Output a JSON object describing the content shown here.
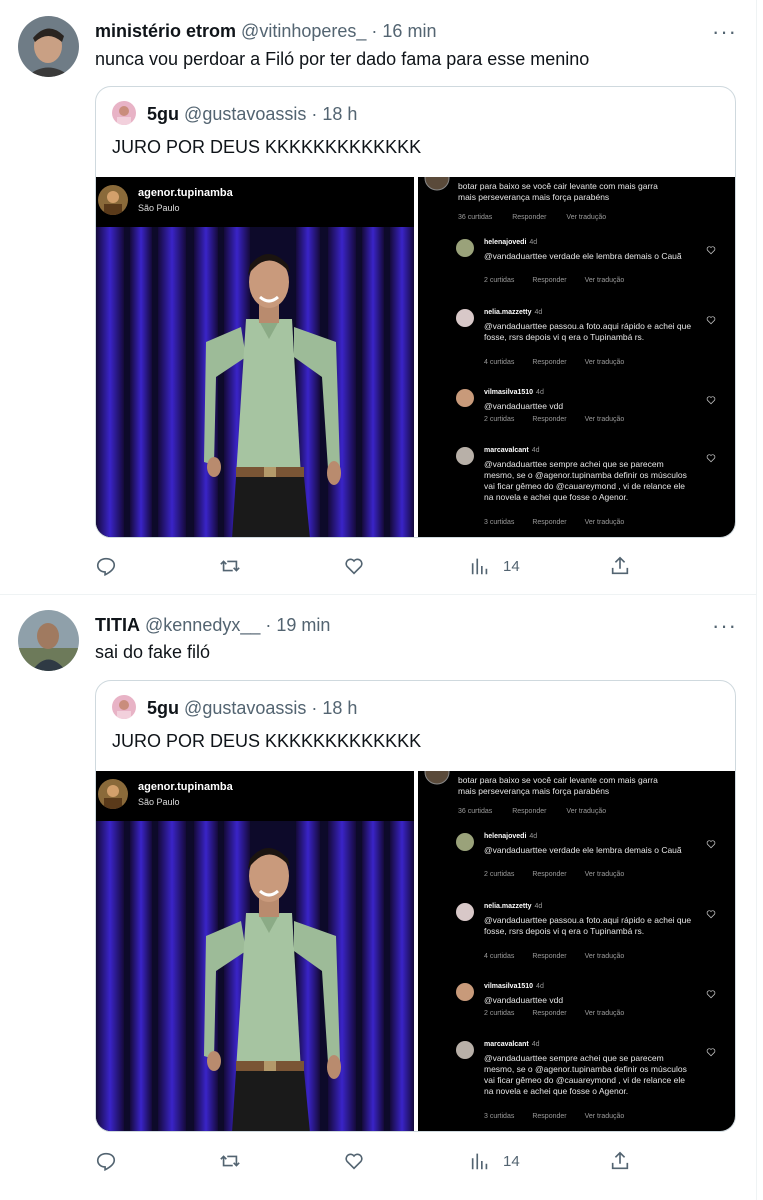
{
  "tweets": [
    {
      "name": "ministério etrom",
      "handle": "@vitinhoperes_",
      "dot": "·",
      "time": "16 min",
      "text": "nunca vou perdoar a Filó por ter dado fama para esse menino",
      "views": "14"
    },
    {
      "name": "TITIA",
      "handle": "@kennedyx__",
      "dot": "·",
      "time": "19 min",
      "text": "sai do fake filó",
      "views": "14"
    }
  ],
  "quote": {
    "name": "5gu",
    "handle": "@gustavoassis",
    "dot": "·",
    "time": "18 h",
    "text": "JURO POR DEUS KKKKKKKKKKKKK"
  },
  "instagram": {
    "user": "agenor.tupinamba",
    "location": "São Paulo",
    "top_comment": [
      "botar para baixo se você cair levante com mais garra",
      "mais perseverança mais força parabéns"
    ],
    "top_meta": [
      "36 curtidas",
      "Responder",
      "Ver tradução"
    ],
    "comments": [
      {
        "user": "helenajovedi",
        "ago": "4d",
        "text": "@vandaduarttee verdade ele lembra demais o Cauã",
        "likes": "2 curtidas",
        "reply": "Responder",
        "translate": "Ver tradução"
      },
      {
        "user": "nelia.mazzetty",
        "ago": "4d",
        "text": "@vandaduarttee passou.a foto.aqui rápido e achei que  fosse, rsrs depois vi q era o Tupinambá rs.",
        "likes": "4 curtidas",
        "reply": "Responder",
        "translate": "Ver tradução"
      },
      {
        "user": "vilmasilva1510",
        "ago": "4d",
        "text": "@vandaduarttee vdd",
        "likes": "2 curtidas",
        "reply": "Responder",
        "translate": "Ver tradução"
      },
      {
        "user": "marcavalcant",
        "ago": "4d",
        "text": "@vandaduarttee sempre achei que se parecem mesmo, se o @agenor.tupinamba definir os músculos vai ficar gêmeo do @cauareymond , vi de relance ele na novela e achei que fosse o Agenor.",
        "likes": "3 curtidas",
        "reply": "Responder",
        "translate": "Ver tradução"
      }
    ]
  },
  "icons": {
    "reply": "reply-icon",
    "retweet": "retweet-icon",
    "like": "like-icon",
    "views": "views-icon",
    "share": "share-icon",
    "more": "more-icon"
  },
  "colors": {
    "muted": "#536471",
    "border": "#cfd9de",
    "shirt": "#9dbb98"
  },
  "more_glyph": "···"
}
